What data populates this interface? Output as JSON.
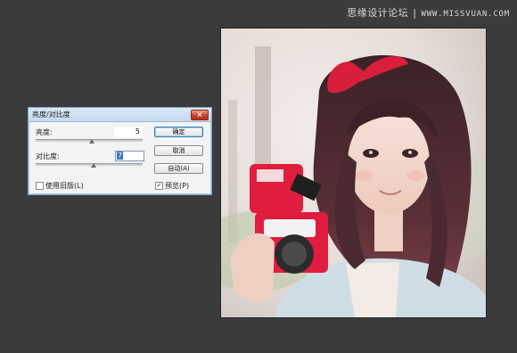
{
  "watermark": {
    "text": "思缘设计论坛",
    "separator": "|",
    "site": "WWW.MISSVUAN.COM"
  },
  "dialog": {
    "title": "亮度/对比度",
    "close_glyph": "×",
    "brightness": {
      "label": "亮度:",
      "value": "5"
    },
    "contrast": {
      "label": "对比度:",
      "value": "7"
    },
    "buttons": {
      "ok": "确定",
      "cancel": "取消",
      "auto": "自动(A)"
    },
    "use_legacy": {
      "label": "使用旧版(L)",
      "checked": false
    },
    "preview": {
      "label": "预览(P)",
      "checked": true,
      "check_glyph": "✓"
    }
  },
  "colors": {
    "workspace_bg": "#3b3b3b",
    "dialog_bg": "#f3f3f3",
    "titlebar": "#c6d9ef",
    "close_red": "#c9432a",
    "selection_blue": "#3a74c9"
  }
}
